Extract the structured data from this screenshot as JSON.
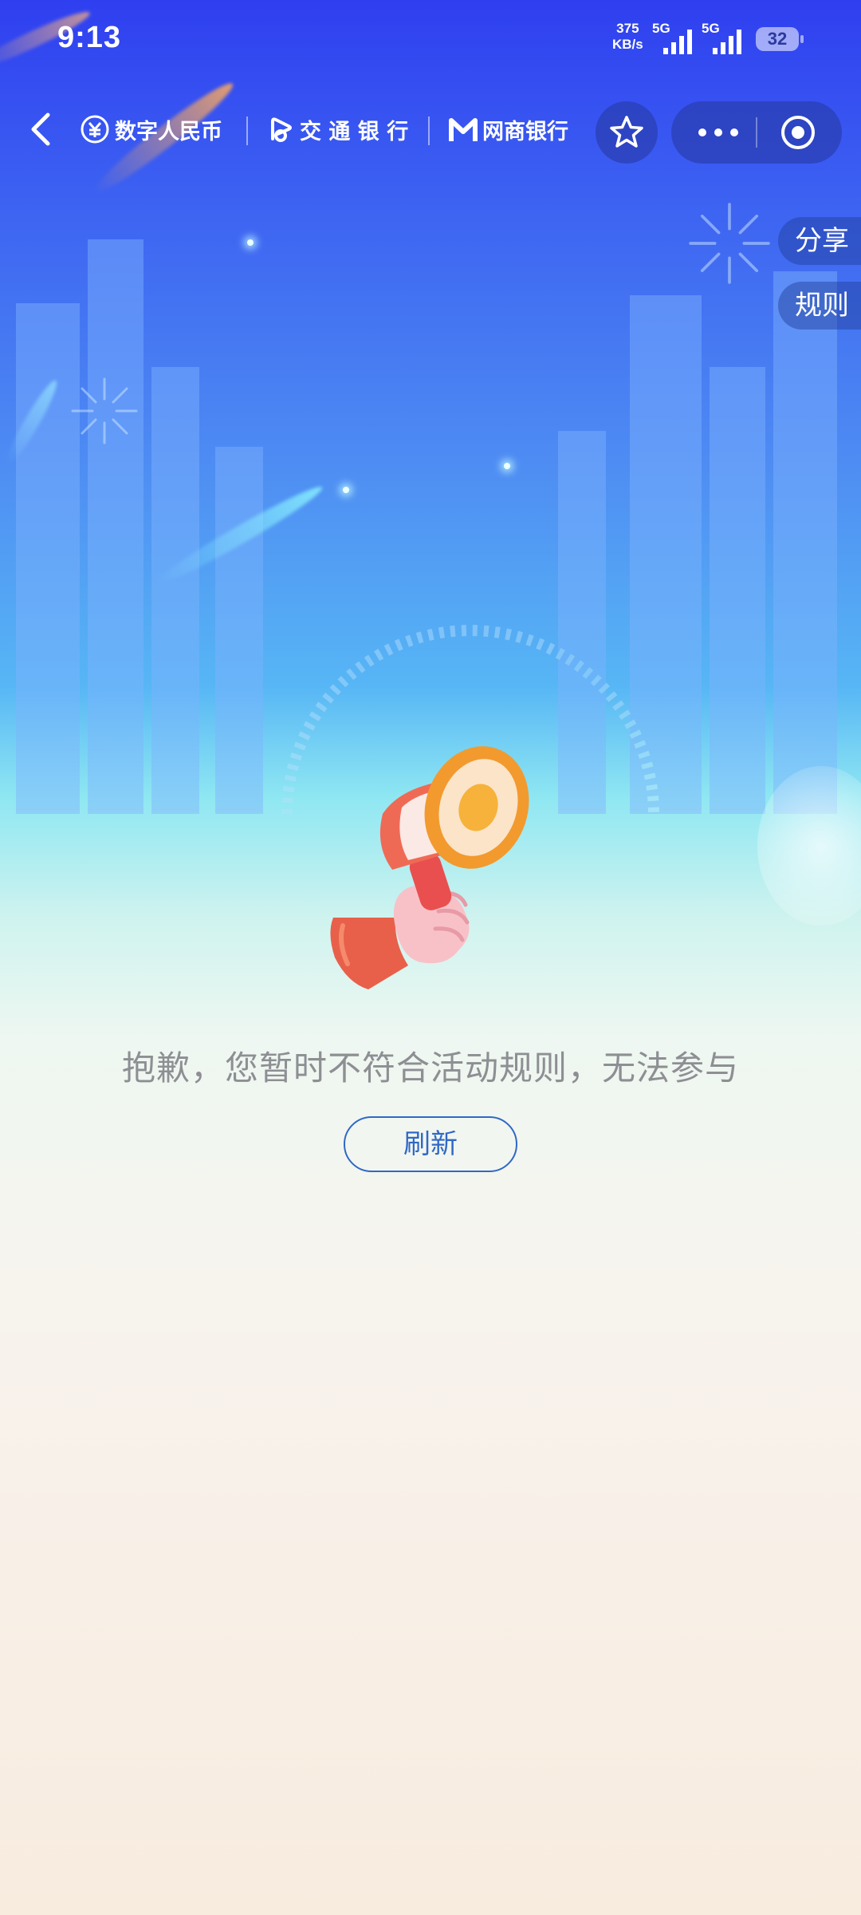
{
  "status_bar": {
    "time": "9:13",
    "net_speed_value": "375",
    "net_speed_unit": "KB/s",
    "signal_1_label": "5G",
    "signal_2_label": "5G",
    "battery": "32"
  },
  "nav": {
    "brands": [
      {
        "label": "数字人民币",
        "icon": "e-cny-icon"
      },
      {
        "label": "交 通 银 行",
        "icon": "bocom-icon"
      },
      {
        "label": "网商银行",
        "icon": "mybank-icon"
      }
    ],
    "icons": {
      "back": "chevron-left-icon",
      "favorite": "star-icon",
      "more": "more-dots-icon",
      "close": "target-circle-icon"
    }
  },
  "side_tabs": {
    "share": "分享",
    "rules": "规则"
  },
  "main": {
    "message": "抱歉，您暂时不符合活动规则，无法参与",
    "refresh_label": "刷新",
    "illustration": "megaphone-hand-icon"
  },
  "colors": {
    "accent": "#2f68c6",
    "message_text": "#8d8f93",
    "header_blue": "#2f3ff0"
  }
}
